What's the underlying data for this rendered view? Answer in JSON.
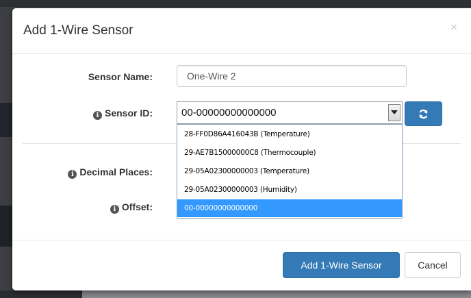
{
  "modal": {
    "title": "Add 1-Wire Sensor",
    "close_glyph": "×"
  },
  "form": {
    "sensor_name": {
      "label": "Sensor Name:",
      "value": "One-Wire 2"
    },
    "sensor_id": {
      "label": "Sensor ID:",
      "selected": "00-00000000000000",
      "options": [
        "28-FF0D86A416043B (Temperature)",
        "29-AE7B15000000C8 (Thermocouple)",
        "29-05A02300000003 (Temperature)",
        "29-05A02300000003 (Humidity)",
        "00-00000000000000"
      ],
      "highlighted_index": 4
    },
    "decimal_places": {
      "label": "Decimal Places:"
    },
    "offset": {
      "label": "Offset:"
    }
  },
  "info_glyph": "i",
  "icons": {
    "info": "info-circle-icon",
    "refresh": "refresh-icon",
    "dropdown": "chevron-down-icon",
    "close": "close-icon"
  },
  "footer": {
    "primary_label": "Add 1-Wire Sensor",
    "cancel_label": "Cancel"
  },
  "colors": {
    "primary": "#337ab7",
    "highlight": "#3399ff",
    "text": "#333333"
  }
}
